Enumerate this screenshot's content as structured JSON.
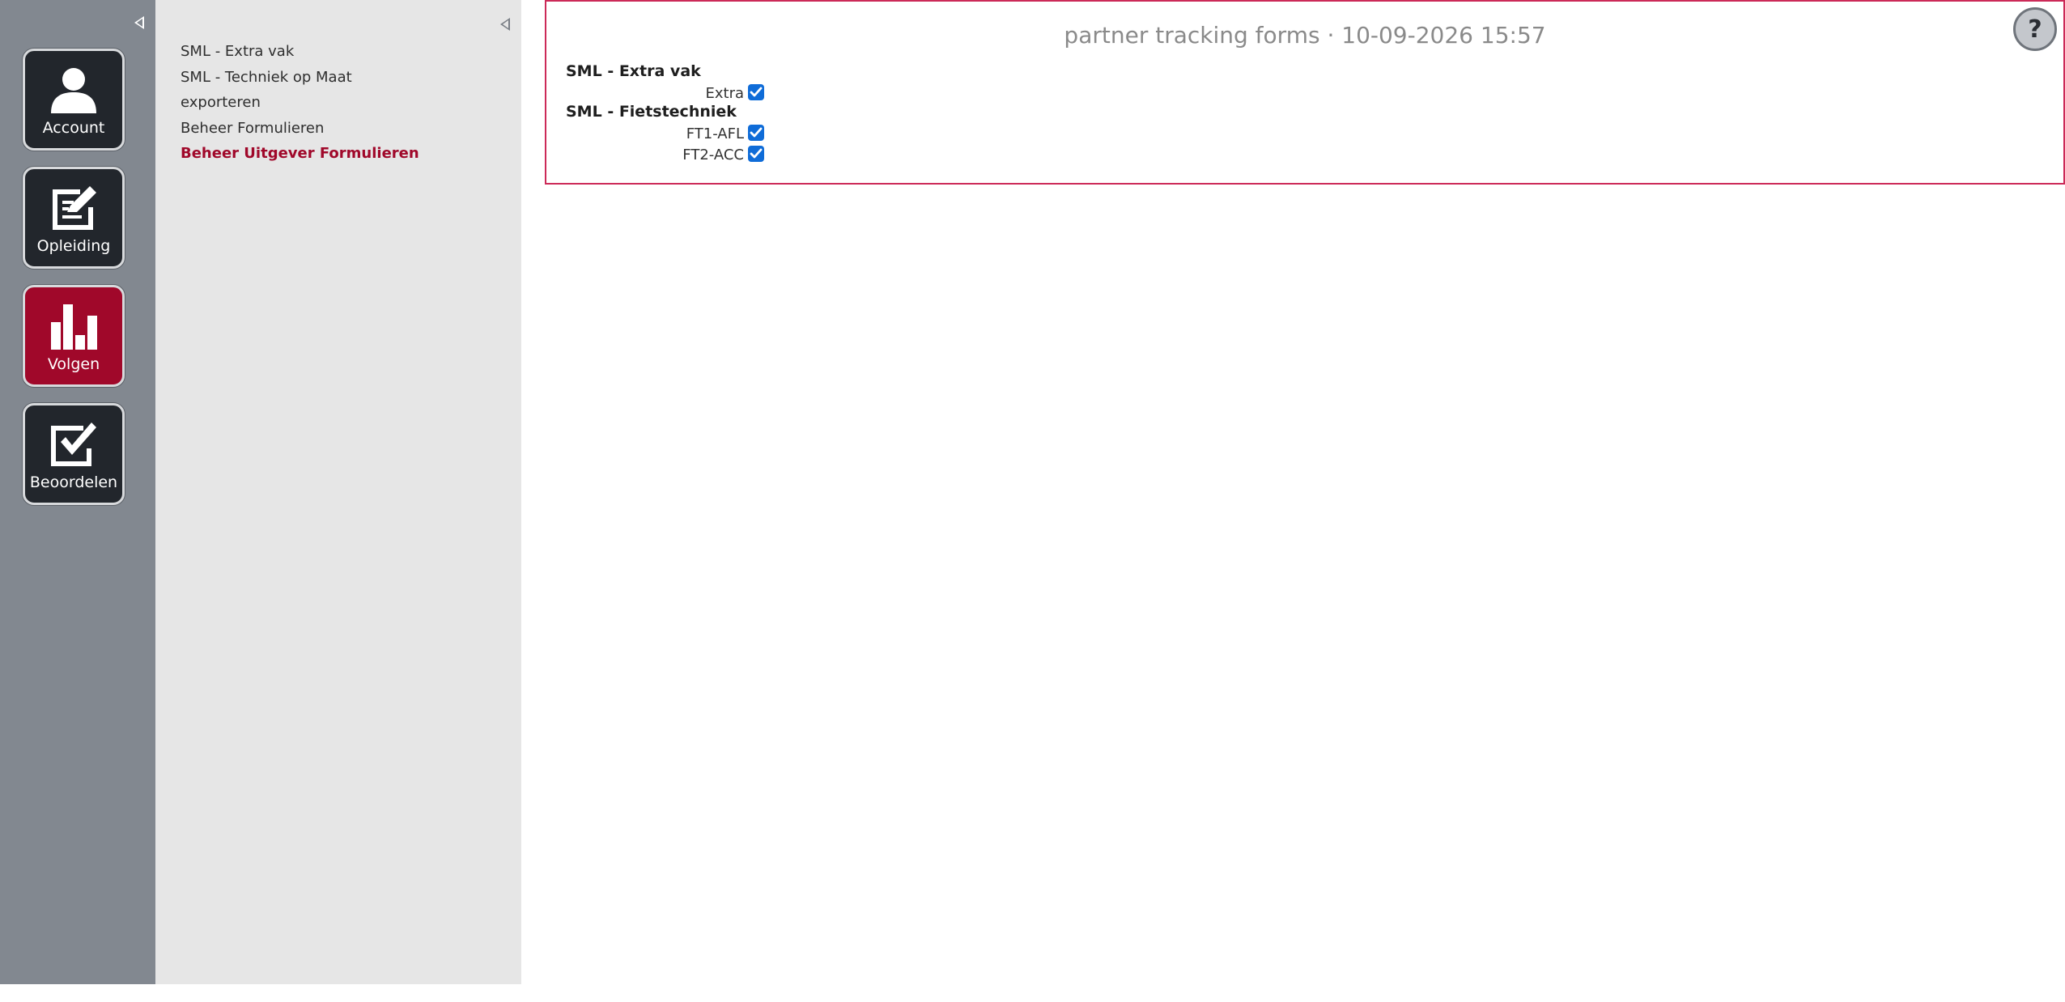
{
  "rail": {
    "tiles": [
      {
        "label": "Account",
        "icon": "person-icon"
      },
      {
        "label": "Opleiding",
        "icon": "edit-document-icon"
      },
      {
        "label": "Volgen",
        "icon": "bar-chart-icon",
        "active": true
      },
      {
        "label": "Beoordelen",
        "icon": "checkbox-icon"
      }
    ]
  },
  "submenu": {
    "items": [
      {
        "label": "SML - Extra vak"
      },
      {
        "label": "SML - Techniek op Maat"
      },
      {
        "label": "exporteren"
      },
      {
        "label": "Beheer Formulieren"
      },
      {
        "label": "Beheer Uitgever Formulieren",
        "active": true
      }
    ]
  },
  "main": {
    "title": "partner tracking forms · 10-09-2026 15:57",
    "help_label": "?",
    "groups": [
      {
        "heading": "SML - Extra vak",
        "fields": [
          {
            "label": "Extra",
            "checked": true
          }
        ]
      },
      {
        "heading": "SML - Fietstechniek",
        "fields": [
          {
            "label": "FT1-AFL",
            "checked": true
          },
          {
            "label": "FT2-ACC",
            "checked": true
          }
        ]
      }
    ]
  },
  "colors": {
    "accent": "#a0082a",
    "rail_bg": "#828890",
    "panel_bg": "#e6e6e6",
    "border_accent": "#cc2a58",
    "checkbox": "#0f6cd8"
  }
}
